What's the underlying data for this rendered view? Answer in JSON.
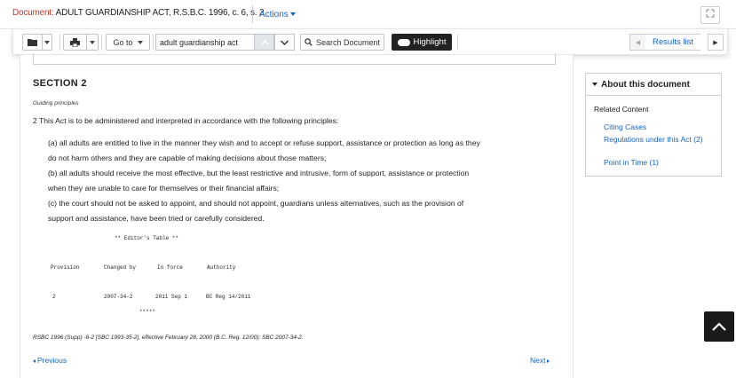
{
  "header": {
    "doc_label": "Document:",
    "doc_title": "ADULT GUARDIANSHIP ACT, R.S.B.C. 1996, c. 6, s. 2",
    "actions_label": "Actions"
  },
  "toolbar": {
    "goto_label": "Go to",
    "search_value": "adult guardianship act",
    "search_doc_label": "Search Document",
    "highlight_label": "Highlight",
    "results_list_label": "Results list"
  },
  "document": {
    "section_title": "SECTION 2",
    "guiding": "Guiding principles",
    "main_para": "2 This Act is to be administered and interpreted in accordance with the following principles:",
    "para_a_1": "(a) all adults are entitled to live in the manner they wish and to accept or refuse support, assistance or protection as long as they",
    "para_a_2": "do not harm others and they are capable of making decisions about those matters;",
    "para_b_1": "(b) all adults should receive the most effective, but the least restrictive and intrusive, form of support, assistance or protection",
    "para_b_2": "when they are unable to care for themselves or their financial affairs;",
    "para_c_1": "(c) the court should not be asked to appoint, and should not appoint, guardians unless alternatives, such as the provision of",
    "para_c_2": "support and assistance, have been tried or carefully considered.",
    "editors_table": {
      "title": "** Editor's Table **",
      "headers": [
        "Provision",
        "Changed by",
        "In force",
        "Authority"
      ],
      "row": [
        "2",
        "2007-34-2",
        "2011 Sep 1",
        "BC Reg 14/2011"
      ],
      "end_marker": "*****"
    },
    "footnote": "RSBC 1996 (Supp) -6-2 [SBC 1993-35-2], effective February 28, 2000 (B.C. Reg. 12/00); SBC 2007-34-2.",
    "prev_label": "Previous",
    "next_label": "Next"
  },
  "sidebar": {
    "about_title": "About this document",
    "related_label": "Related Content",
    "links": [
      "Citing Cases",
      "Regulations under this Act (2)",
      "Point in Time (1)"
    ]
  },
  "colors": {
    "link": "#1565c0",
    "doc_label": "#c0392b",
    "highlight_bg": "#222222"
  }
}
